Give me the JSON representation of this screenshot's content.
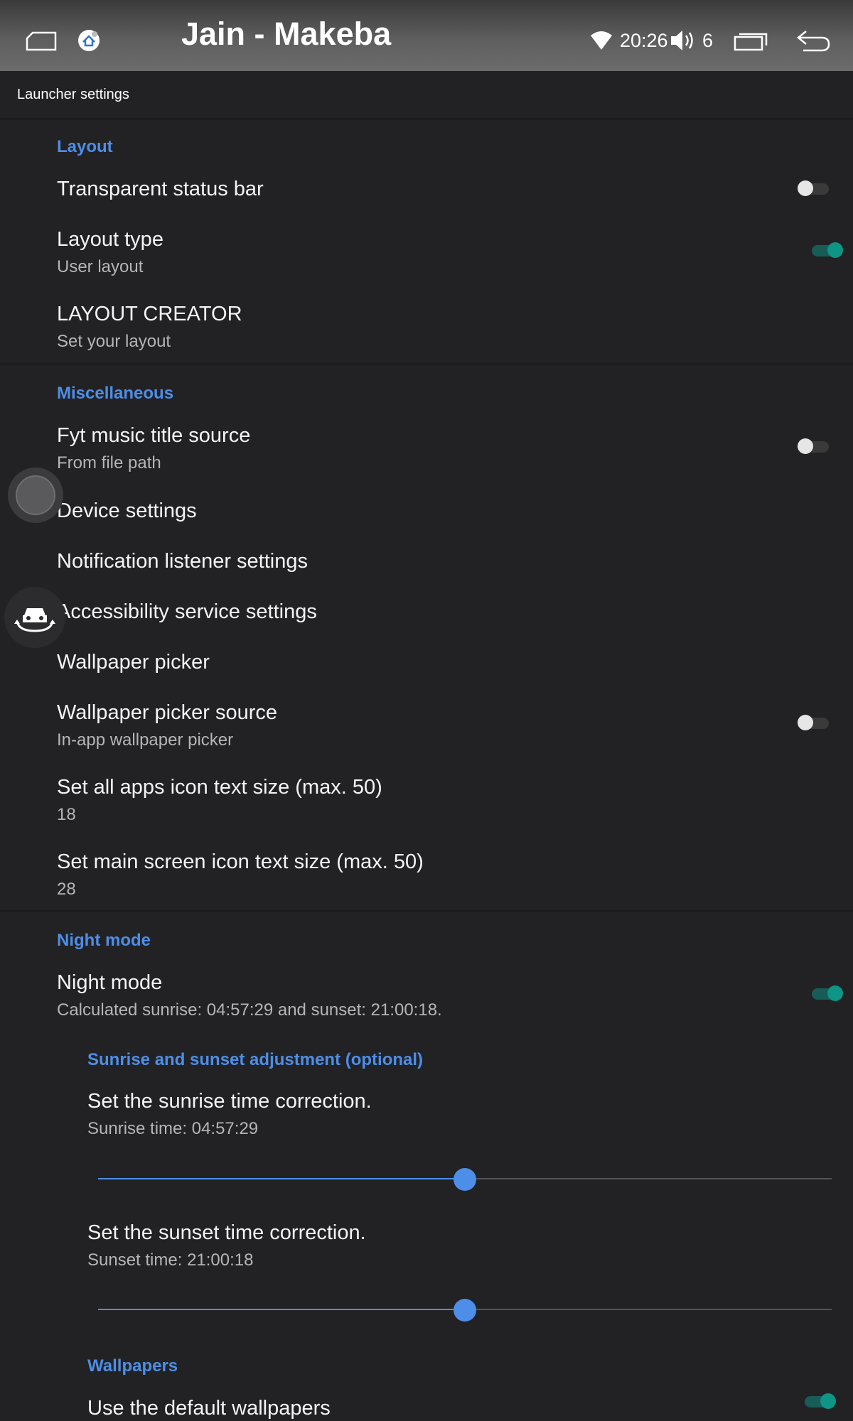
{
  "statusbar": {
    "title": "Jain - Makeba",
    "time": "20:26",
    "volume": "6",
    "icons": [
      "home-icon",
      "launcher-app-icon",
      "wifi-icon",
      "speaker-icon",
      "recent-apps-icon",
      "back-icon"
    ]
  },
  "header": {
    "title": "Launcher settings"
  },
  "colors": {
    "accent": "#4d8ee8",
    "toggle_on": "#0e9585",
    "background": "#222224"
  },
  "layout": {
    "title": "Layout",
    "transparent_status_bar": {
      "title": "Transparent status bar",
      "enabled": false
    },
    "layout_type": {
      "title": "Layout type",
      "summary": "User layout",
      "enabled": true
    },
    "layout_creator": {
      "title": "LAYOUT CREATOR",
      "summary": "Set your layout"
    }
  },
  "misc": {
    "title": "Miscellaneous",
    "fyt_music": {
      "title": "Fyt music title source",
      "summary": "From file path",
      "enabled": false
    },
    "device_settings": {
      "title": "Device settings"
    },
    "notification_listener": {
      "title": "Notification listener settings"
    },
    "accessibility": {
      "title": "Accessibility service settings"
    },
    "wallpaper_picker": {
      "title": "Wallpaper picker"
    },
    "wallpaper_source": {
      "title": "Wallpaper picker source",
      "summary": "In-app wallpaper picker",
      "enabled": false
    },
    "all_apps_text_size": {
      "title": "Set all apps icon text size (max. 50)",
      "summary": "18"
    },
    "main_screen_text_size": {
      "title": "Set main screen icon text size (max. 50)",
      "summary": "28"
    }
  },
  "night": {
    "title": "Night mode",
    "night_mode": {
      "title": "Night mode",
      "summary": "Calculated sunrise: 04:57:29 and sunset: 21:00:18.",
      "enabled": true
    },
    "adjust_title": "Sunrise and sunset adjustment (optional)",
    "sunrise": {
      "title": "Set the sunrise time correction.",
      "summary": "Sunrise time: 04:57:29",
      "slider_fraction": 0.5
    },
    "sunset": {
      "title": "Set the sunset time correction.",
      "summary": "Sunset time: 21:00:18",
      "slider_fraction": 0.5
    }
  },
  "wallpapers": {
    "title": "Wallpapers",
    "default": {
      "title": "Use the default wallpapers",
      "enabled": true
    }
  }
}
